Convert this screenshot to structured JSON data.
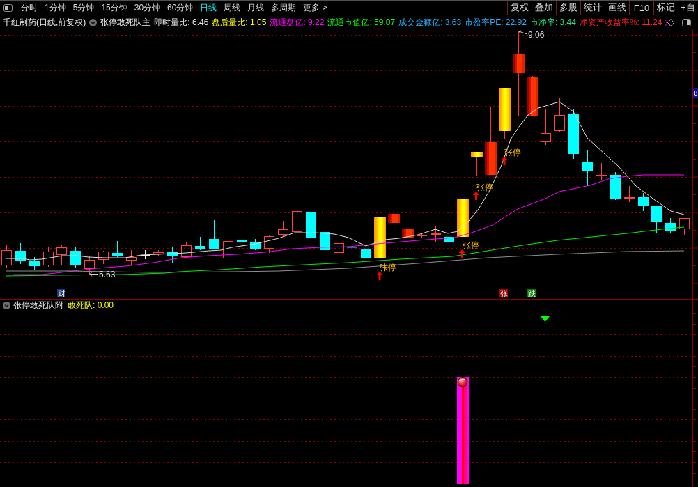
{
  "toolbar": {
    "periods": [
      {
        "label": "分时",
        "selected": false
      },
      {
        "label": "1分钟",
        "selected": false
      },
      {
        "label": "5分钟",
        "selected": false
      },
      {
        "label": "15分钟",
        "selected": false
      },
      {
        "label": "30分钟",
        "selected": false
      },
      {
        "label": "60分钟",
        "selected": false
      },
      {
        "label": "日线",
        "selected": true
      },
      {
        "label": "周线",
        "selected": false
      },
      {
        "label": "月线",
        "selected": false
      },
      {
        "label": "多周期",
        "selected": false
      },
      {
        "label": "更多 >",
        "selected": false
      }
    ],
    "buttons": [
      "复权",
      "叠加",
      "多股",
      "统计",
      "画线",
      "F10",
      "标记",
      "+自"
    ]
  },
  "info_bar": {
    "title": "千红制药(日线,前复权)",
    "indicator": "张停敢死队主",
    "stats": [
      {
        "text": "即时量比: 6.46",
        "color": "#e8e8e8"
      },
      {
        "text": "盘后量比: 1.05",
        "color": "#ffff00"
      },
      {
        "text": "流通盘亿: 9.22",
        "color": "#ff00ff"
      },
      {
        "text": "流通市值亿: 59.07",
        "color": "#00ff00"
      },
      {
        "text": "成交金额亿: 3.63",
        "color": "#20b0ff"
      },
      {
        "text": "市盈率PE: 22.92",
        "color": "#20b0ff"
      },
      {
        "text": "市净率: 3.44",
        "color": "#20e080"
      },
      {
        "text": "净资产收益率%: 11.24",
        "color": "#ff2020"
      }
    ]
  },
  "main_chart": {
    "high_label": "9.06",
    "low_label": "5.63",
    "axis_label": "8",
    "signals": [
      {
        "label": "张停"
      },
      {
        "label": "张停"
      },
      {
        "label": "张停"
      },
      {
        "label": "张停"
      }
    ],
    "tags": [
      {
        "text": "财",
        "kind": "finance"
      },
      {
        "text": "张",
        "kind": "rise"
      },
      {
        "text": "跌",
        "kind": "fall"
      }
    ]
  },
  "sub_chart": {
    "indicator": "张停敢死队附",
    "reading": "敢死队: 0.00"
  }
}
